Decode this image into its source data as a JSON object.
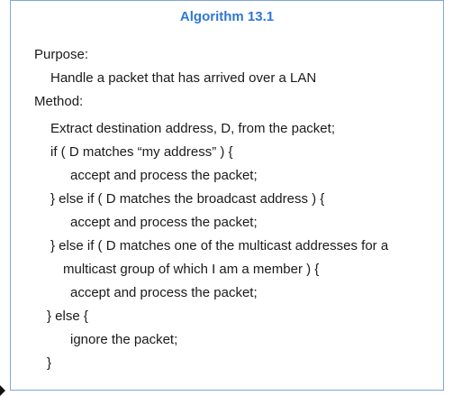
{
  "algorithm": {
    "title": "Algorithm 13.1",
    "purpose_label": "Purpose:",
    "purpose_text": "Handle a packet that has arrived over a LAN",
    "method_label": "Method:",
    "method_lines": [
      "Extract destination address, D, from the packet;",
      "if  ( D matches “my address” )  {",
      "accept and process the packet;",
      "}  else if  ( D matches the broadcast address )  {",
      "accept and process the packet;",
      "}  else if  ( D matches one of the multicast addresses for a",
      "multicast group of which I am a member )  {",
      "accept and process the packet;",
      "}  else  {",
      "ignore the packet;",
      "}"
    ]
  }
}
